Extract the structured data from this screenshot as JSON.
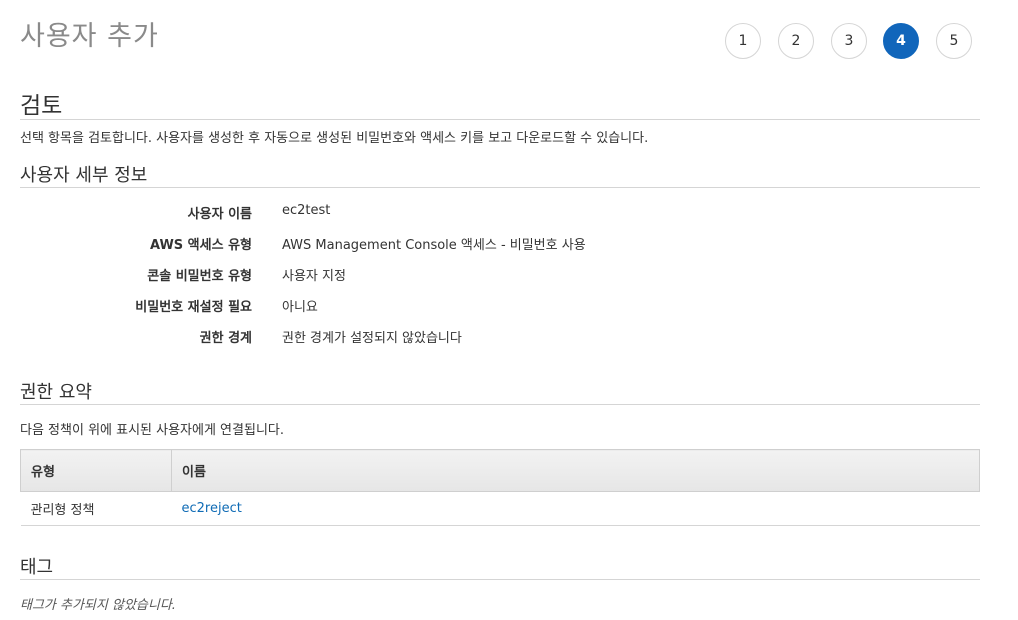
{
  "header": {
    "title": "사용자 추가",
    "steps": [
      "1",
      "2",
      "3",
      "4",
      "5"
    ],
    "active_step": 4
  },
  "review": {
    "title": "검토",
    "description": "선택 항목을 검토합니다. 사용자를 생성한 후 자동으로 생성된 비밀번호와 액세스 키를 보고 다운로드할 수 있습니다."
  },
  "user_details": {
    "title": "사용자 세부 정보",
    "rows": [
      {
        "label": "사용자 이름",
        "value": "ec2test"
      },
      {
        "label": "AWS 액세스 유형",
        "value": "AWS Management Console 액세스 - 비밀번호 사용"
      },
      {
        "label": "콘솔 비밀번호 유형",
        "value": "사용자 지정"
      },
      {
        "label": "비밀번호 재설정 필요",
        "value": "아니요"
      },
      {
        "label": "권한 경계",
        "value": "권한 경계가 설정되지 않았습니다"
      }
    ]
  },
  "permissions": {
    "title": "권한 요약",
    "description": "다음 정책이 위에 표시된 사용자에게 연결됩니다.",
    "columns": [
      "유형",
      "이름"
    ],
    "rows": [
      {
        "type": "관리형 정책",
        "name": "ec2reject"
      }
    ]
  },
  "tags": {
    "title": "태그",
    "empty_message": "태그가 추가되지 않았습니다."
  },
  "colors": {
    "accent": "#1166bb",
    "link": "#0f6bb5",
    "title_gray": "#8a8a8a"
  }
}
